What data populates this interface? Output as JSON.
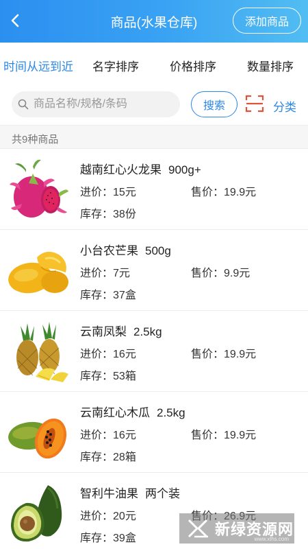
{
  "header": {
    "title": "商品(水果仓库)",
    "add_label": "添加商品"
  },
  "sort_tabs": [
    "时间从远到近",
    "名字排序",
    "价格排序",
    "数量排序"
  ],
  "search": {
    "placeholder": "商品名称/规格/条码",
    "button_label": "搜索",
    "category_label": "分类"
  },
  "summary": {
    "count_text": "共9种商品"
  },
  "labels": {
    "cost": "进价：",
    "sale": "售价：",
    "stock": "库存："
  },
  "products": [
    {
      "name": "越南红心火龙果",
      "spec": "900g+",
      "cost": "15元",
      "sale": "19.9元",
      "stock": "38份",
      "icon": "dragon-fruit"
    },
    {
      "name": "小台农芒果",
      "spec": "500g",
      "cost": "7元",
      "sale": "9.9元",
      "stock": "37盒",
      "icon": "mango"
    },
    {
      "name": "云南凤梨",
      "spec": "2.5kg",
      "cost": "16元",
      "sale": "19.9元",
      "stock": "53箱",
      "icon": "pineapple"
    },
    {
      "name": "云南红心木瓜",
      "spec": "2.5kg",
      "cost": "16元",
      "sale": "19.9元",
      "stock": "28箱",
      "icon": "papaya"
    },
    {
      "name": "智利牛油果",
      "spec": "两个装",
      "cost": "20元",
      "sale": "26.9元",
      "stock": "39盒",
      "icon": "avocado"
    }
  ],
  "watermark": {
    "text": "新绿资源网",
    "url": "www.xlhs.com"
  },
  "colors": {
    "accent": "#2b87e8",
    "header_start": "#2b8ff0",
    "header_end": "#52bdf2",
    "scan": "#e0533a"
  }
}
